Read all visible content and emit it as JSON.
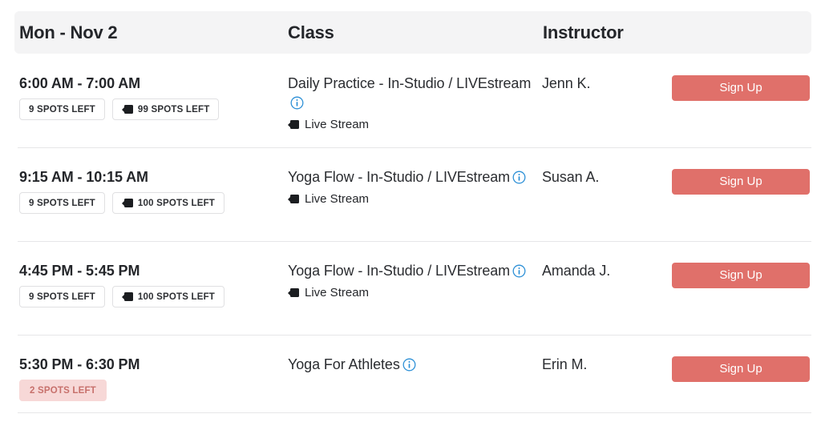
{
  "header": {
    "date_label": "Mon - Nov 2",
    "class_label": "Class",
    "instructor_label": "Instructor"
  },
  "colors": {
    "header_bg": "#f4f4f5",
    "signup_button": "#e0706a",
    "info_icon": "#2b8fd6",
    "low_badge_bg": "#f7d8d7",
    "low_badge_text": "#c7706b",
    "divider": "#e6e6e8",
    "text": "#24262a"
  },
  "signup_label": "Sign Up",
  "live_stream_label": "Live Stream",
  "icons": {
    "camera": "video-camera-icon",
    "info": "info-circle-icon"
  },
  "rows": [
    {
      "time": "6:00 AM - 7:00 AM",
      "badges": [
        {
          "text": "9 SPOTS LEFT",
          "camera": false,
          "low": false
        },
        {
          "text": "99 SPOTS LEFT",
          "camera": true,
          "low": false
        }
      ],
      "class_name": "Daily Practice - In-Studio / LIVEstream",
      "has_info": true,
      "live_stream": true,
      "instructor": "Jenn K."
    },
    {
      "time": "9:15 AM - 10:15 AM",
      "badges": [
        {
          "text": "9 SPOTS LEFT",
          "camera": false,
          "low": false
        },
        {
          "text": "100 SPOTS LEFT",
          "camera": true,
          "low": false
        }
      ],
      "class_name": "Yoga Flow - In-Studio / LIVEstream",
      "has_info": true,
      "live_stream": true,
      "instructor": "Susan A."
    },
    {
      "time": "4:45 PM - 5:45 PM",
      "badges": [
        {
          "text": "9 SPOTS LEFT",
          "camera": false,
          "low": false
        },
        {
          "text": "100 SPOTS LEFT",
          "camera": true,
          "low": false
        }
      ],
      "class_name": "Yoga Flow - In-Studio / LIVEstream",
      "has_info": true,
      "live_stream": true,
      "instructor": "Amanda J."
    },
    {
      "time": "5:30 PM - 6:30 PM",
      "badges": [
        {
          "text": "2 SPOTS LEFT",
          "camera": false,
          "low": true
        }
      ],
      "class_name": "Yoga For Athletes",
      "has_info": true,
      "live_stream": false,
      "instructor": "Erin M."
    }
  ]
}
